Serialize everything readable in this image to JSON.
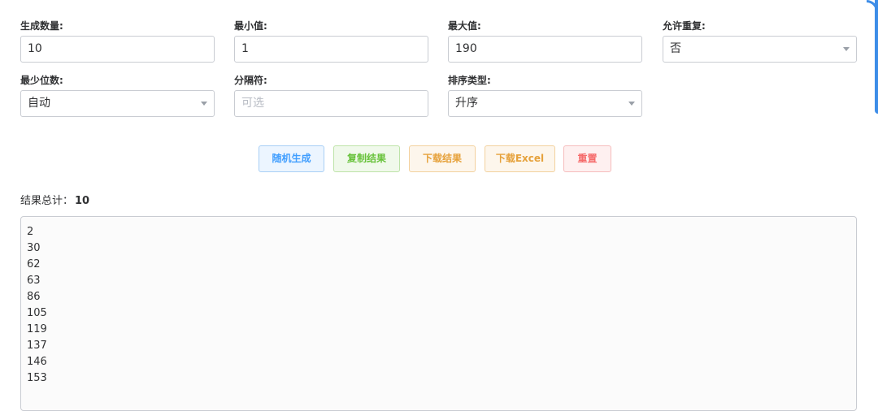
{
  "form": {
    "count": {
      "label": "生成数量:",
      "value": "10"
    },
    "min": {
      "label": "最小值:",
      "value": "1"
    },
    "max": {
      "label": "最大值:",
      "value": "190"
    },
    "repeat": {
      "label": "允许重复:",
      "value": "否"
    },
    "digits": {
      "label": "最少位数:",
      "value": "自动"
    },
    "separator": {
      "label": "分隔符:",
      "value": "",
      "placeholder": "可选"
    },
    "sort": {
      "label": "排序类型:",
      "value": "升序"
    }
  },
  "buttons": {
    "generate": "随机生成",
    "copy": "复制结果",
    "download": "下载结果",
    "download_excel": "下载Excel",
    "reset": "重置"
  },
  "result": {
    "total_label": "结果总计：",
    "total_value": "10",
    "values": [
      "2",
      "30",
      "62",
      "63",
      "86",
      "105",
      "119",
      "137",
      "146",
      "153"
    ]
  },
  "colors": {
    "primary": "#409eff",
    "success": "#67c23a",
    "warning": "#e6a23c",
    "danger": "#f56c6c",
    "accent": "#3d8de8"
  }
}
